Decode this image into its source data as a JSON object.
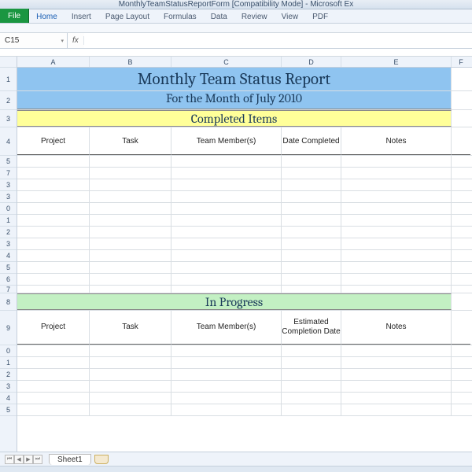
{
  "window": {
    "title": "MonthlyTeamStatusReportForm  [Compatibility Mode] - Microsoft Ex"
  },
  "ribbon": {
    "file": "File",
    "tabs": [
      "Home",
      "Insert",
      "Page Layout",
      "Formulas",
      "Data",
      "Review",
      "View",
      "PDF"
    ]
  },
  "namebox": "C15",
  "fx_label": "fx",
  "formula": "",
  "columns": [
    "A",
    "B",
    "C",
    "D",
    "E",
    "F"
  ],
  "rownums": [
    "1",
    "2",
    "3",
    "4",
    "5",
    "7",
    "3",
    "3",
    "0",
    "1",
    "2",
    "3",
    "4",
    "5",
    "6",
    "7",
    "8",
    "9",
    "0",
    "1",
    "2",
    "3",
    "4",
    "5"
  ],
  "report": {
    "title": "Monthly Team Status Report",
    "subtitle": "For the Month of July 2010",
    "section_completed": "Completed Items",
    "headers_completed": {
      "project": "Project",
      "task": "Task",
      "team": "Team Member(s)",
      "date": "Date Completed",
      "notes": "Notes"
    },
    "section_progress": "In Progress",
    "headers_progress": {
      "project": "Project",
      "task": "Task",
      "team": "Team Member(s)",
      "date": "Estimated Completion Date",
      "notes": "Notes"
    }
  },
  "sheet_tab": "Sheet1"
}
